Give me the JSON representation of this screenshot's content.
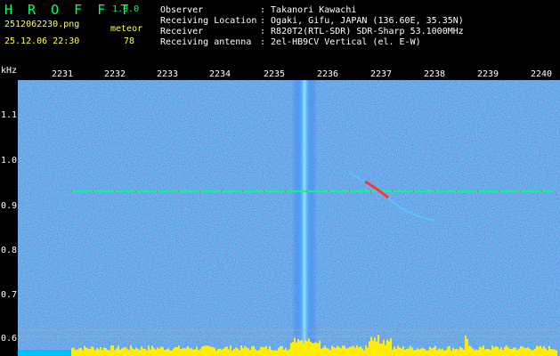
{
  "header": {
    "title": "H R O F F T",
    "version": "1.0.0",
    "filename": "2512062230.png",
    "datetime": "25.12.06 22:30",
    "mode_label": "meteor",
    "count": "78",
    "labels": {
      "observer": "Observer",
      "location": "Receiving Location",
      "receiver": "Receiver",
      "antenna": "Receiving antenna"
    },
    "values": {
      "observer": ": Takanori Kawachi",
      "location": ": Ogaki, Gifu, JAPAN (136.60E, 35.35N)",
      "receiver": ": R820T2(RTL-SDR) SDR-Sharp 53.1000MHz",
      "antenna": ": 2el-HB9CV Vertical (el. E-W)"
    }
  },
  "axes": {
    "y_unit": "kHz",
    "top_ticks": [
      "2231",
      "2232",
      "2233",
      "2234",
      "2235",
      "2236",
      "2237",
      "2238",
      "2239",
      "2240"
    ],
    "left_ticks": [
      "1.1",
      "1.0",
      "0.9",
      "0.8",
      "0.7",
      "0.6"
    ]
  },
  "colors": {
    "background": "#000000",
    "spectrum_base": "#0a1a8c",
    "signal": "#00ff88",
    "meteor": "#ff3333",
    "bars": "#ffee00",
    "text_green": "#00ff66",
    "text_yellow": "#ffff55"
  }
}
